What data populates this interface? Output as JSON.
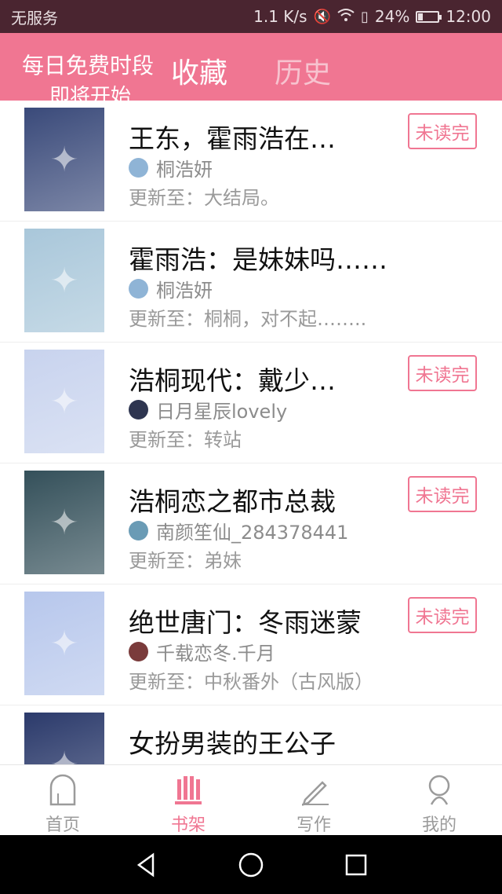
{
  "status_bar": {
    "carrier": "无服务",
    "net_speed": "1.1 K/s",
    "battery_percent_label": "24%",
    "battery_level": 0.24,
    "time": "12:00"
  },
  "header": {
    "promo_line1": "每日免费时段",
    "promo_line2": "即将开始",
    "tab_collect": "收藏",
    "tab_history": "历史"
  },
  "books": [
    {
      "title": "王东，霍雨浩在…",
      "author": "桐浩妍",
      "update": "更新至：大结局。",
      "badge": "未读完",
      "cover_color": "#3a4a7a",
      "avatar_color": "#8fb4d6"
    },
    {
      "title": "霍雨浩：是妹妹吗……",
      "author": "桐浩妍",
      "update": "更新至：桐桐，对不起……..",
      "badge": "",
      "cover_color": "#a9c7da",
      "avatar_color": "#8fb4d6"
    },
    {
      "title": "浩桐现代：戴少…",
      "author": "日月星辰lovely",
      "update": "更新至：转站",
      "badge": "未读完",
      "cover_color": "#c8d3ee",
      "avatar_color": "#2e3550"
    },
    {
      "title": "浩桐恋之都市总裁",
      "author": "南颜笙仙_284378441",
      "update": "更新至：弟妹",
      "badge": "未读完",
      "cover_color": "#34505a",
      "avatar_color": "#6a9bb5"
    },
    {
      "title": "绝世唐门：冬雨迷蒙",
      "author": "千载恋冬.千月",
      "update": "更新至：中秋番外（古风版）",
      "badge": "未读完",
      "cover_color": "#b7c7ec",
      "avatar_color": "#7a3b3b"
    },
    {
      "title": "女扮男装的王公子",
      "author": "",
      "update": "",
      "badge": "",
      "cover_color": "#2b3a6b",
      "avatar_color": "#8fb4d6"
    }
  ],
  "bottom_nav": [
    {
      "label": "首页",
      "icon": "home-icon"
    },
    {
      "label": "书架",
      "icon": "bookshelf-icon"
    },
    {
      "label": "写作",
      "icon": "pencil-icon"
    },
    {
      "label": "我的",
      "icon": "profile-icon"
    }
  ],
  "colors": {
    "accent": "#f07692",
    "status_bar": "#4a2530"
  }
}
